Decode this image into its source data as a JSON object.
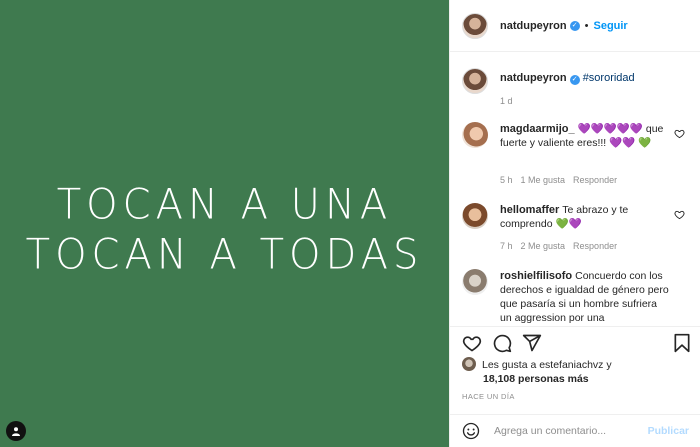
{
  "post": {
    "image_text_line1": "TOCAN A UNA",
    "image_text_line2": "TOCAN A TODAS",
    "background_color": "#3f7a4f"
  },
  "header": {
    "username": "natdupeyron",
    "separator": "•",
    "follow_label": "Seguir"
  },
  "caption": {
    "username": "natdupeyron",
    "hashtag": "#sororidad",
    "time": "1 d"
  },
  "comments": [
    {
      "username": "magdaarmijo_",
      "text": "💜💜💜💜💜 que fuerte y valiente eres!!! 💜💜 💚",
      "time": "5 h",
      "likes": "1 Me gusta",
      "reply": "Responder"
    },
    {
      "username": "hellomaffer",
      "text": "Te abrazo y te comprendo 💚💜",
      "time": "7 h",
      "likes": "2 Me gusta",
      "reply": "Responder"
    },
    {
      "username": "roshielfilisofo",
      "text": "Concuerdo con los derechos e igualdad de género pero que pasaría si un hombre sufriera un aggression por una"
    }
  ],
  "likes": {
    "text_line1": "Les gusta a estefaniachvz y",
    "text_line2": "18,108 personas más"
  },
  "time_ago": "HACE UN DÍA",
  "add_comment": {
    "placeholder": "Agrega un comentario...",
    "publish_label": "Publicar"
  },
  "icons": [
    "verified-icon",
    "heart-icon",
    "comment-icon",
    "share-icon",
    "bookmark-icon",
    "emoji-icon",
    "tag-user-icon"
  ],
  "colors": {
    "accent": "#0095f6",
    "verified": "#3897f0",
    "hashtag": "#00376b",
    "muted": "#8e8e8e"
  }
}
